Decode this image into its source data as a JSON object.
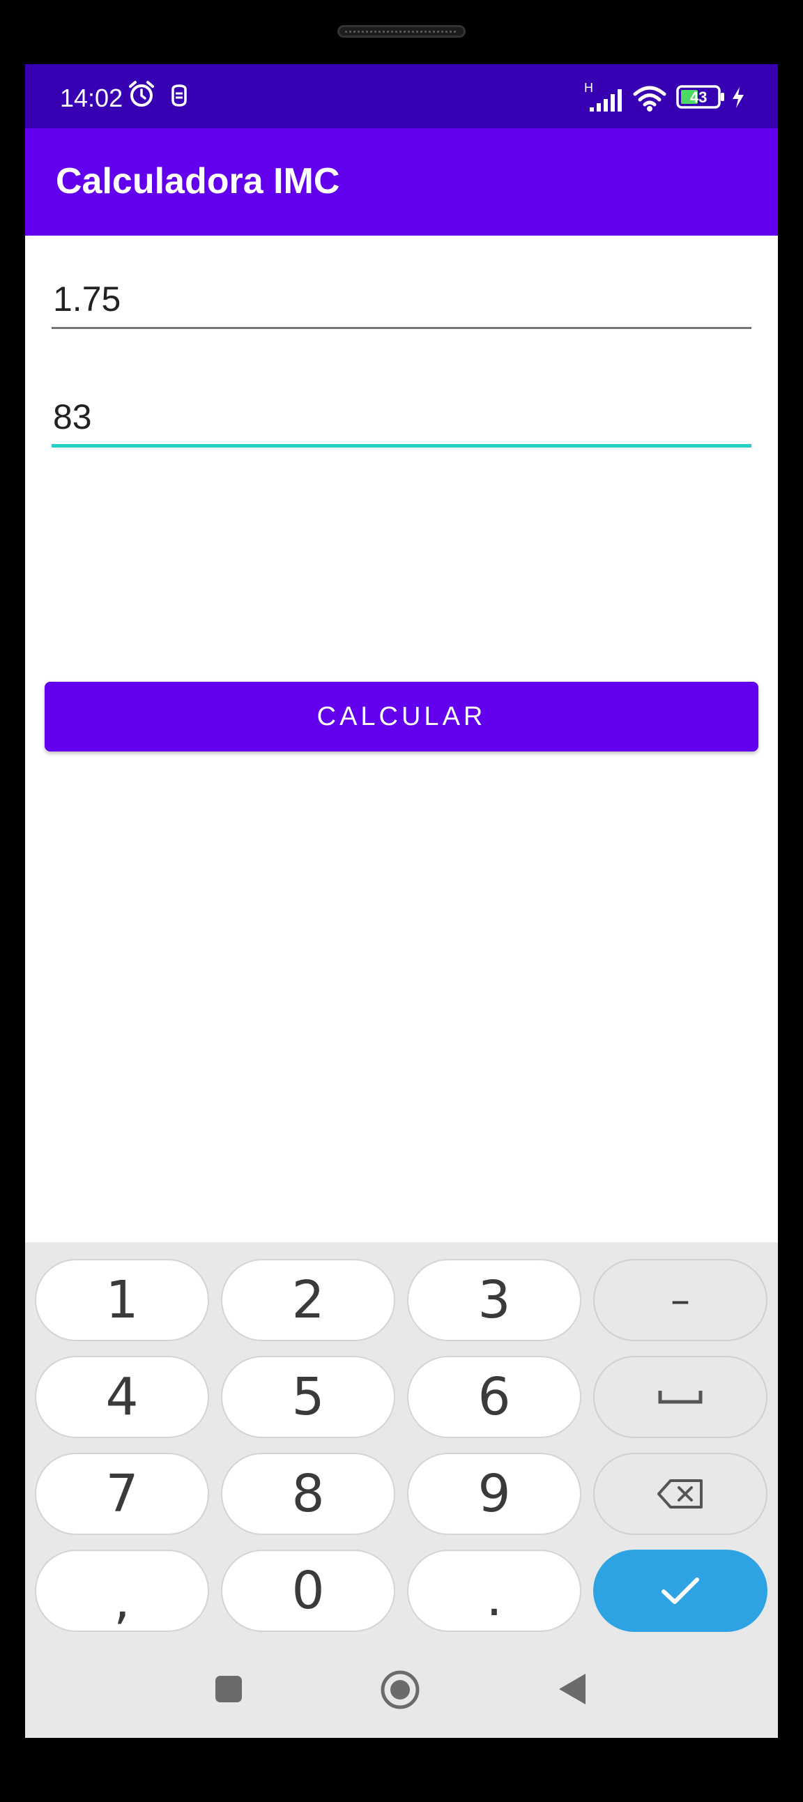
{
  "status_bar": {
    "time": "14:02",
    "network_label": "H",
    "battery_level": "43",
    "icons": [
      "alarm-icon",
      "notification-icon",
      "signal-icon",
      "wifi-icon",
      "battery-icon",
      "charging-icon"
    ]
  },
  "app_bar": {
    "title": "Calculadora IMC"
  },
  "form": {
    "height_value": "1.75",
    "weight_value": "83",
    "calculate_label": "CALCULAR"
  },
  "keyboard": {
    "rows": [
      [
        "1",
        "2",
        "3",
        "–"
      ],
      [
        "4",
        "5",
        "6",
        "space"
      ],
      [
        "7",
        "8",
        "9",
        "backspace"
      ],
      [
        ",",
        "0",
        ".",
        "done"
      ]
    ],
    "labels": {
      "k1": "1",
      "k2": "2",
      "k3": "3",
      "dash": "–",
      "k4": "4",
      "k5": "5",
      "k6": "6",
      "k7": "7",
      "k8": "8",
      "k9": "9",
      "comma": ",",
      "k0": "0",
      "period": "."
    },
    "icons": [
      "space-icon",
      "backspace-icon",
      "check-icon"
    ]
  },
  "nav_bar": {
    "icons": [
      "recents-icon",
      "home-icon",
      "back-icon"
    ]
  },
  "colors": {
    "status_bar": "#3700b3",
    "primary": "#6200ee",
    "focus_accent": "#26d0c7",
    "done_key": "#2ea3e3",
    "keyboard_bg": "#e8e8e8"
  }
}
